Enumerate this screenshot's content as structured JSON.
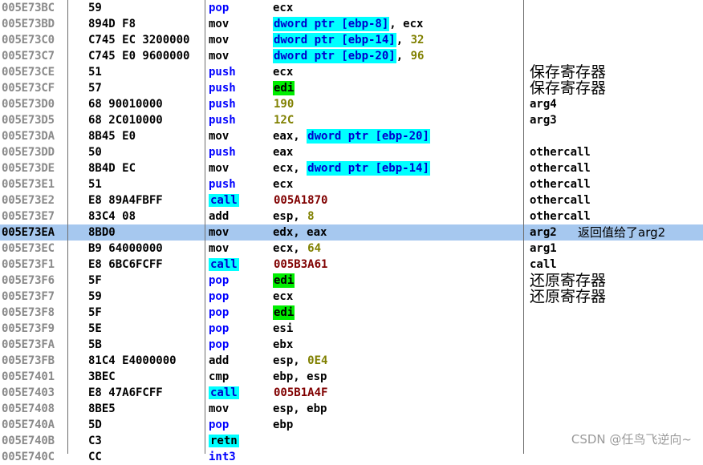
{
  "rows": [
    {
      "addr": "005E73BC",
      "hex": "59",
      "mn": "pop",
      "mn_style": "blue",
      "ops": [
        {
          "t": "ecx"
        }
      ],
      "cmt": ""
    },
    {
      "addr": "005E73BD",
      "hex": "894D F8",
      "mn": "mov",
      "mn_style": "black",
      "ops": [
        {
          "t": "dword ptr [ebp-8]",
          "s": "mem"
        },
        {
          "t": ", ecx"
        }
      ],
      "cmt": ""
    },
    {
      "addr": "005E73C0",
      "hex": "C745 EC 3200000",
      "mn": "mov",
      "mn_style": "black",
      "ops": [
        {
          "t": "dword ptr [ebp-14]",
          "s": "mem"
        },
        {
          "t": ", "
        },
        {
          "t": "32",
          "s": "num"
        }
      ],
      "cmt": ""
    },
    {
      "addr": "005E73C7",
      "hex": "C745 E0 9600000",
      "mn": "mov",
      "mn_style": "black",
      "ops": [
        {
          "t": "dword ptr [ebp-20]",
          "s": "mem"
        },
        {
          "t": ", "
        },
        {
          "t": "96",
          "s": "num"
        }
      ],
      "cmt": ""
    },
    {
      "addr": "005E73CE",
      "hex": "51",
      "mn": "push",
      "mn_style": "blue",
      "ops": [
        {
          "t": "ecx"
        }
      ],
      "cmt": "保存寄存器",
      "cmt_cjk": true
    },
    {
      "addr": "005E73CF",
      "hex": "57",
      "mn": "push",
      "mn_style": "blue",
      "ops": [
        {
          "t": "edi",
          "s": "reg"
        }
      ],
      "cmt": "保存寄存器",
      "cmt_cjk": true
    },
    {
      "addr": "005E73D0",
      "hex": "68 90010000",
      "mn": "push",
      "mn_style": "blue",
      "ops": [
        {
          "t": "190",
          "s": "num"
        }
      ],
      "cmt": "arg4"
    },
    {
      "addr": "005E73D5",
      "hex": "68 2C010000",
      "mn": "push",
      "mn_style": "blue",
      "ops": [
        {
          "t": "12C",
          "s": "num"
        }
      ],
      "cmt": "arg3"
    },
    {
      "addr": "005E73DA",
      "hex": "8B45 E0",
      "mn": "mov",
      "mn_style": "black",
      "ops": [
        {
          "t": "eax, "
        },
        {
          "t": "dword ptr [ebp-20]",
          "s": "mem"
        }
      ],
      "cmt": ""
    },
    {
      "addr": "005E73DD",
      "hex": "50",
      "mn": "push",
      "mn_style": "blue",
      "ops": [
        {
          "t": "eax"
        }
      ],
      "cmt": "othercall"
    },
    {
      "addr": "005E73DE",
      "hex": "8B4D EC",
      "mn": "mov",
      "mn_style": "black",
      "ops": [
        {
          "t": "ecx, "
        },
        {
          "t": "dword ptr [ebp-14]",
          "s": "mem"
        }
      ],
      "cmt": "othercall"
    },
    {
      "addr": "005E73E1",
      "hex": "51",
      "mn": "push",
      "mn_style": "blue",
      "ops": [
        {
          "t": "ecx"
        }
      ],
      "cmt": "othercall"
    },
    {
      "addr": "005E73E2",
      "hex": "E8 89A4FBFF",
      "mn": "call",
      "mn_style": "call",
      "ops": [
        {
          "t": "005A1870",
          "s": "addr"
        }
      ],
      "cmt": "othercall"
    },
    {
      "addr": "005E73E7",
      "hex": "83C4 08",
      "mn": "add",
      "mn_style": "black",
      "ops": [
        {
          "t": "esp, "
        },
        {
          "t": "8",
          "s": "num"
        }
      ],
      "cmt": "othercall"
    },
    {
      "addr": "005E73EA",
      "hex": "8BD0",
      "mn": "mov",
      "mn_style": "black",
      "ops": [
        {
          "t": "edx, eax"
        }
      ],
      "cmt": "arg2",
      "note": "返回值给了arg2",
      "selected": true
    },
    {
      "addr": "005E73EC",
      "hex": "B9 64000000",
      "mn": "mov",
      "mn_style": "black",
      "ops": [
        {
          "t": "ecx, "
        },
        {
          "t": "64",
          "s": "num"
        }
      ],
      "cmt": "arg1"
    },
    {
      "addr": "005E73F1",
      "hex": "E8 6BC6FCFF",
      "mn": "call",
      "mn_style": "call",
      "ops": [
        {
          "t": "005B3A61",
          "s": "addr"
        }
      ],
      "cmt": "call"
    },
    {
      "addr": "005E73F6",
      "hex": "5F",
      "mn": "pop",
      "mn_style": "blue",
      "ops": [
        {
          "t": "edi",
          "s": "reg"
        }
      ],
      "cmt": "还原寄存器",
      "cmt_cjk": true
    },
    {
      "addr": "005E73F7",
      "hex": "59",
      "mn": "pop",
      "mn_style": "blue",
      "ops": [
        {
          "t": "ecx"
        }
      ],
      "cmt": "还原寄存器",
      "cmt_cjk": true
    },
    {
      "addr": "005E73F8",
      "hex": "5F",
      "mn": "pop",
      "mn_style": "blue",
      "ops": [
        {
          "t": "edi",
          "s": "reg"
        }
      ],
      "cmt": ""
    },
    {
      "addr": "005E73F9",
      "hex": "5E",
      "mn": "pop",
      "mn_style": "blue",
      "ops": [
        {
          "t": "esi"
        }
      ],
      "cmt": ""
    },
    {
      "addr": "005E73FA",
      "hex": "5B",
      "mn": "pop",
      "mn_style": "blue",
      "ops": [
        {
          "t": "ebx"
        }
      ],
      "cmt": ""
    },
    {
      "addr": "005E73FB",
      "hex": "81C4 E4000000",
      "mn": "add",
      "mn_style": "black",
      "ops": [
        {
          "t": "esp, "
        },
        {
          "t": "0E4",
          "s": "num"
        }
      ],
      "cmt": ""
    },
    {
      "addr": "005E7401",
      "hex": "3BEC",
      "mn": "cmp",
      "mn_style": "black",
      "ops": [
        {
          "t": "ebp, esp"
        }
      ],
      "cmt": ""
    },
    {
      "addr": "005E7403",
      "hex": "E8 47A6FCFF",
      "mn": "call",
      "mn_style": "call",
      "ops": [
        {
          "t": "005B1A4F",
          "s": "addr"
        }
      ],
      "cmt": ""
    },
    {
      "addr": "005E7408",
      "hex": "8BE5",
      "mn": "mov",
      "mn_style": "black",
      "ops": [
        {
          "t": "esp, ebp"
        }
      ],
      "cmt": ""
    },
    {
      "addr": "005E740A",
      "hex": "5D",
      "mn": "pop",
      "mn_style": "blue",
      "ops": [
        {
          "t": "ebp"
        }
      ],
      "cmt": ""
    },
    {
      "addr": "005E740B",
      "hex": "C3",
      "mn": "retn",
      "mn_style": "retn",
      "ops": [],
      "cmt": ""
    },
    {
      "addr": "005E740C",
      "hex": "CC",
      "mn": "int3",
      "mn_style": "blue",
      "ops": [],
      "cmt": ""
    }
  ],
  "watermark": "CSDN @任鸟飞逆向~",
  "colors": {
    "selected_row": "#a6c8ef",
    "memory_operand_bg": "#00ffff",
    "register_highlight_bg": "#00ee00",
    "immediate_value": "#808000",
    "call_target": "#800000",
    "mnemonic_blue": "#0000ff"
  }
}
